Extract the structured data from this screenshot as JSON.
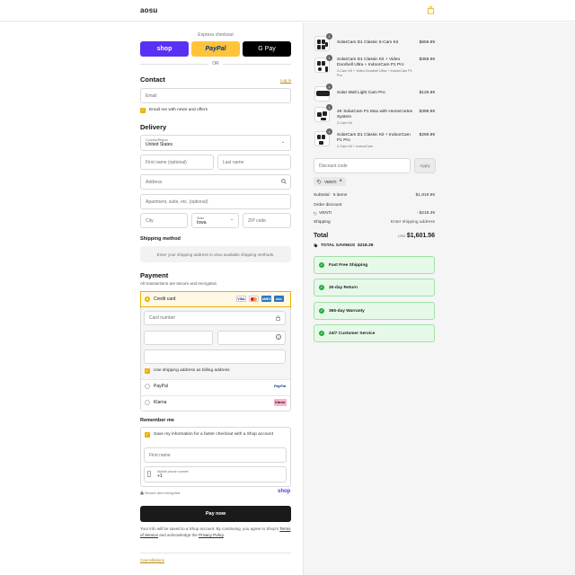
{
  "header": {
    "logo": "aosu",
    "cart_icon": "shopping-bag-icon"
  },
  "express": {
    "label": "Express checkout",
    "buttons": [
      {
        "label": "shop",
        "bg": "#5a31f4",
        "color": "#ffffff"
      },
      {
        "label": "PayPal",
        "bg": "#ffc439",
        "color": "#003087"
      },
      {
        "label": "G Pay",
        "bg": "#000000",
        "color": "#ffffff"
      }
    ],
    "or": "OR"
  },
  "contact": {
    "title": "Contact",
    "login": "Log in",
    "email_placeholder": "Email",
    "news_label": "Email me with news and offers"
  },
  "delivery": {
    "title": "Delivery",
    "country_label": "Country/Region",
    "country_value": "United States",
    "first_name": "First name (optional)",
    "last_name": "Last name",
    "address": "Address",
    "apartment": "Apartment, suite, etc. (optional)",
    "city": "City",
    "state_label": "State",
    "state_value": "Iowa",
    "zip": "ZIP code"
  },
  "shipping_method": {
    "title": "Shipping method",
    "message": "Enter your shipping address to view available shipping methods."
  },
  "payment": {
    "title": "Payment",
    "subtitle": "All transactions are secure and encrypted.",
    "credit_card": "Credit card",
    "card_logos": [
      "VISA",
      "MC",
      "AMEX",
      "DISC"
    ],
    "card_number": "Card number",
    "billing_label": "Use shipping address as billing address",
    "paypal": "PayPal",
    "paypal_logo": "PayPal",
    "klarna": "Klarna",
    "klarna_logo": "Klarna."
  },
  "remember": {
    "title": "Remember me",
    "save_label": "Save my information for a faster checkout with a Shop account",
    "first_name": "First name",
    "phone_label": "Mobile phone number",
    "phone_value": "+1",
    "secure": "Secure and encrypted",
    "shop": "shop"
  },
  "pay_now": "Pay now",
  "legal": {
    "text1": "Your info will be saved to a Shop account. By continuing, you agree to Shop's",
    "terms": "Terms of Service",
    "text2": "and acknowledge the",
    "privacy": "Privacy Policy",
    "end": "."
  },
  "cancellations": "Cancellations",
  "order": {
    "items": [
      {
        "qty": "1",
        "name": "SolarCam D1 Classic 6-Cam Kit",
        "variant": "",
        "price": "$659.99"
      },
      {
        "qty": "1",
        "name": "SolarCam D1 Classic Kit + Video Doorbell Ultra + IndoorCam P1 Pro",
        "variant": "2-Cam Kit + Video Doorbell Ultra + IndoorCam P1 Pro",
        "price": "$359.99"
      },
      {
        "qty": "1",
        "name": "Solar Wall Light Cam Pro",
        "variant": "",
        "price": "$129.99"
      },
      {
        "qty": "1",
        "name": "4K SolarCam P1 Max with HomeCortex System",
        "variant": "2-Cam Kit",
        "price": "$399.99"
      },
      {
        "qty": "1",
        "name": "SolarCam D1 Classic Kit + IndoorCam P1 Pro",
        "variant": "2-Cam Kit + IndoorCam",
        "price": "$269.99"
      }
    ],
    "discount_placeholder": "Discount code",
    "apply": "Apply",
    "code": "VENTI",
    "subtotal_label": "Subtotal · 5 items",
    "subtotal": "$1,819.95",
    "order_discount_label": "Order discount",
    "discount_code": "VENTI",
    "discount_amount": "- $218.39",
    "shipping_label": "Shipping",
    "shipping_value": "Enter shipping address",
    "total_label": "Total",
    "currency": "USD",
    "total": "$1,601.56",
    "savings_label": "TOTAL SAVINGS",
    "savings": "$218.39"
  },
  "features": [
    "Fast Free Shipping",
    "30-day Return",
    "365-day Warranty",
    "24/7 Customer Service"
  ]
}
